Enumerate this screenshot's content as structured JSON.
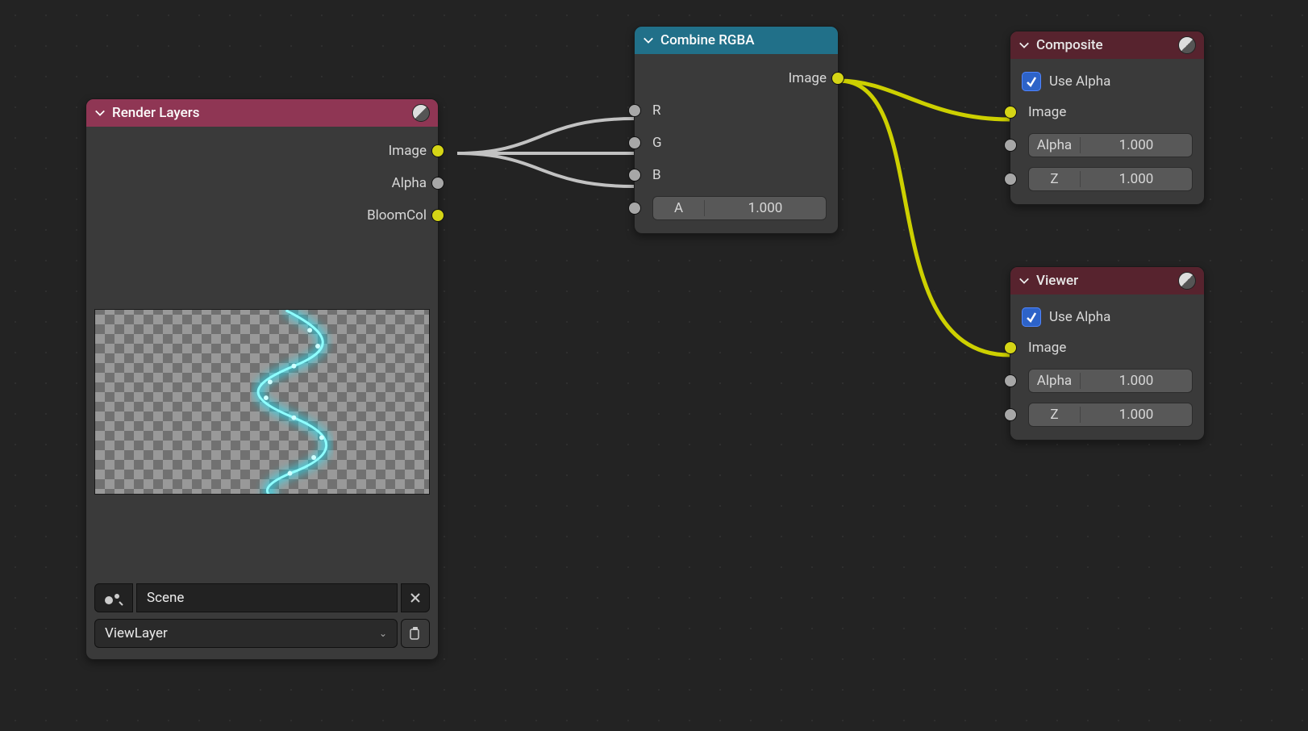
{
  "nodes": {
    "render_layers": {
      "title": "Render Layers",
      "outputs": {
        "image": "Image",
        "alpha": "Alpha",
        "bloom": "BloomCol"
      },
      "scene_field": "Scene",
      "view_layer_field": "ViewLayer"
    },
    "combine_rgba": {
      "title": "Combine RGBA",
      "output": "Image",
      "inputs": {
        "r": "R",
        "g": "G",
        "b": "B",
        "a_label": "A",
        "a_value": "1.000"
      }
    },
    "composite": {
      "title": "Composite",
      "use_alpha_label": "Use Alpha",
      "image_input": "Image",
      "alpha_label": "Alpha",
      "alpha_value": "1.000",
      "z_label": "Z",
      "z_value": "1.000"
    },
    "viewer": {
      "title": "Viewer",
      "use_alpha_label": "Use Alpha",
      "image_input": "Image",
      "alpha_label": "Alpha",
      "alpha_value": "1.000",
      "z_label": "Z",
      "z_value": "1.000"
    }
  }
}
